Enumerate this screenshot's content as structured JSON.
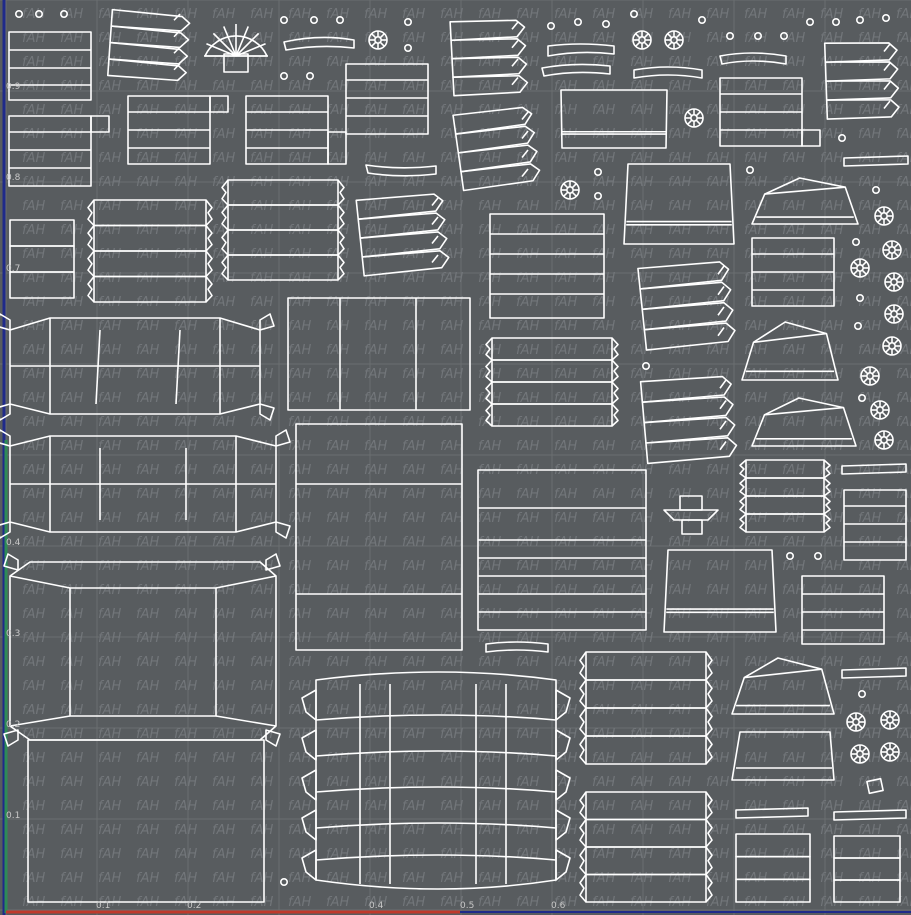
{
  "editor": {
    "view": "UV texture editor",
    "watermark_text": "fAH"
  },
  "axis": {
    "y_ticks": [
      {
        "label": "0.9",
        "value": 0.9
      },
      {
        "label": "0.8",
        "value": 0.8
      },
      {
        "label": "0.7",
        "value": 0.7
      },
      {
        "label": "0.4",
        "value": 0.4
      },
      {
        "label": "0.3",
        "value": 0.3
      },
      {
        "label": "0.2",
        "value": 0.2
      },
      {
        "label": "0.1",
        "value": 0.1
      }
    ],
    "x_ticks": [
      {
        "label": "0.1",
        "value": 0.1
      },
      {
        "label": "0.2",
        "value": 0.2
      },
      {
        "label": "0.4",
        "value": 0.4
      },
      {
        "label": "0.5",
        "value": 0.5
      },
      {
        "label": "0.6",
        "value": 0.6
      }
    ]
  },
  "colors": {
    "background": "#585c5f",
    "grid": "#6a6e71",
    "wire": "#ffffff",
    "u_axis": "#c0392b",
    "v_axis": "#2e8b57",
    "border": "#1f2a8a"
  }
}
